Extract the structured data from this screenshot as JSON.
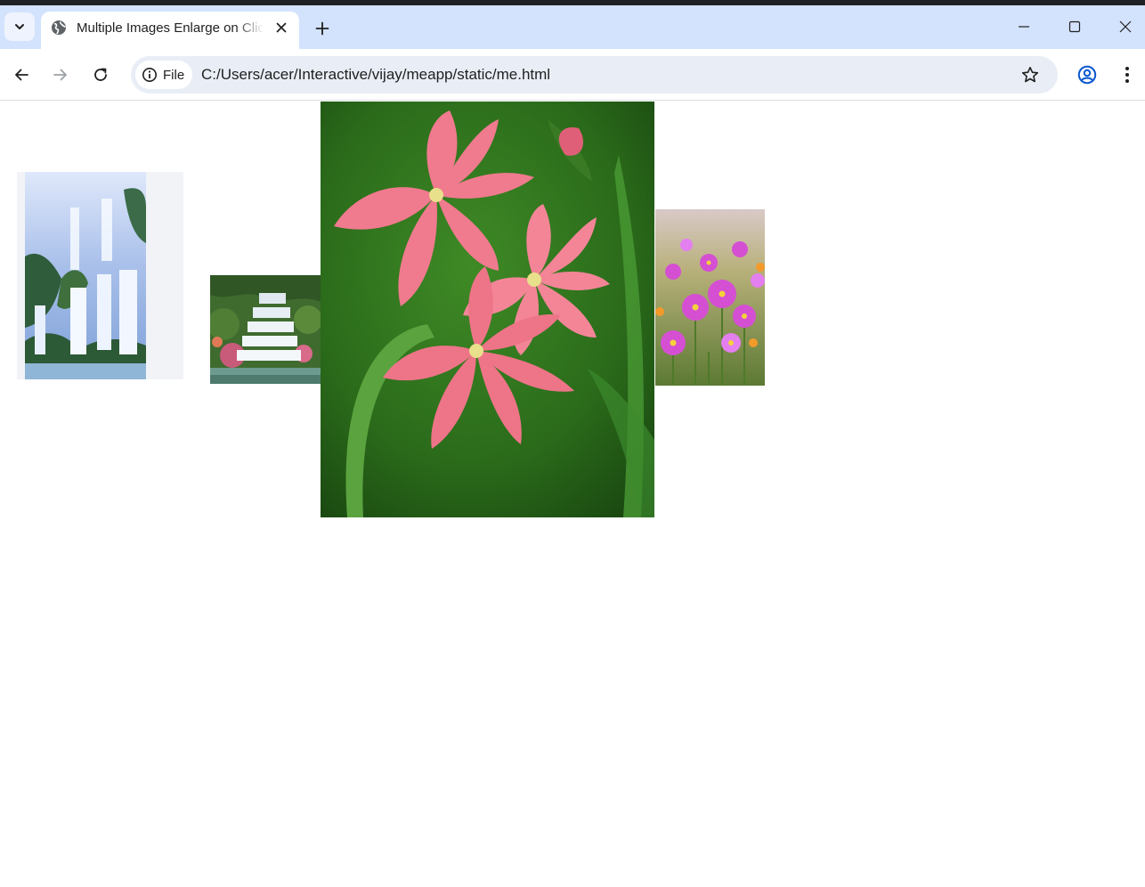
{
  "browser": {
    "tab": {
      "title": "Multiple Images Enlarge on Click"
    },
    "address": {
      "scheme_chip": "File",
      "url": "C:/Users/acer/Interactive/vijay/meapp/static/me.html"
    }
  },
  "gallery": {
    "images": [
      {
        "subject": "waterfall"
      },
      {
        "subject": "cascading-waterfall"
      },
      {
        "subject": "pink-lily-flowers",
        "enlarged": true
      },
      {
        "subject": "purple-daisy-field"
      }
    ]
  },
  "colors": {
    "tabbar": "#d3e3fd",
    "omnibox": "#e9eef6",
    "accent": "#0b57d0"
  }
}
